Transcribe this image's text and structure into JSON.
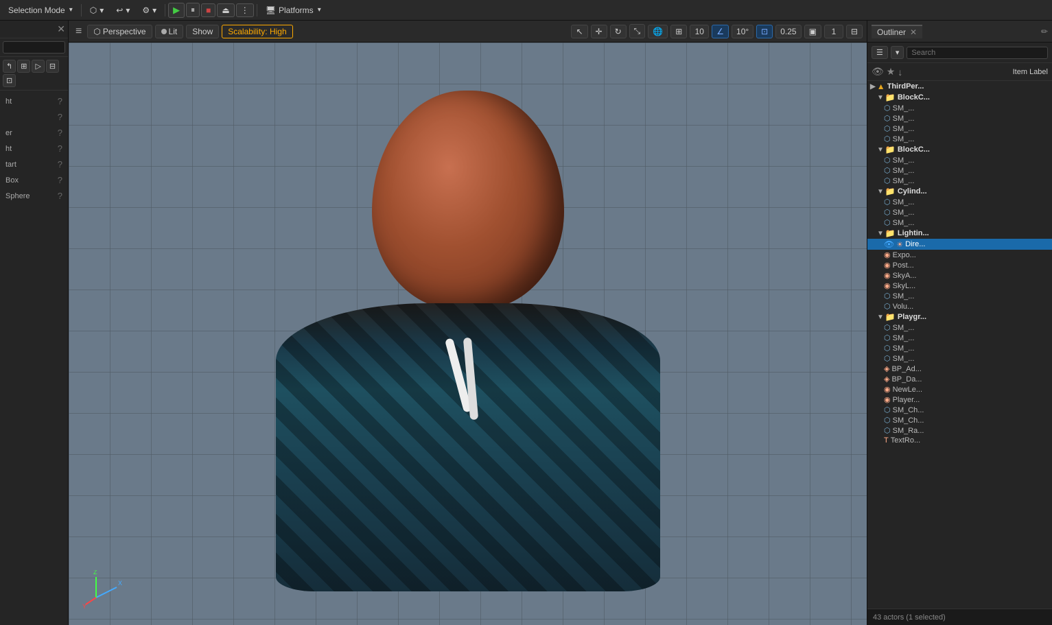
{
  "topbar": {
    "selection_mode_label": "Selection Mode",
    "selection_mode_arrow": "▾",
    "platforms_label": "Platforms",
    "platforms_arrow": "▾",
    "play_btn": "▶",
    "pause_btn": "⏸",
    "stop_btn": "■",
    "eject_btn": "⏏",
    "more_btn": "⋮",
    "blueprint_icon": "⬡",
    "history_icon": "↩",
    "settings_icon": "⚙",
    "cinematics_icon": "🎬"
  },
  "left_panel": {
    "search_placeholder": "",
    "items": [
      {
        "label": "ht",
        "has_help": true
      },
      {
        "label": "",
        "has_help": true
      },
      {
        "label": "er",
        "has_help": true
      },
      {
        "label": "ht",
        "has_help": true
      },
      {
        "label": "tart",
        "has_help": true
      },
      {
        "label": "Box",
        "has_help": true
      },
      {
        "label": "Sphere",
        "has_help": true
      }
    ]
  },
  "viewport": {
    "perspective_label": "Perspective",
    "lit_label": "Lit",
    "show_label": "Show",
    "scalability_label": "Scalability: High",
    "grid_num": "10",
    "angle_num": "10°",
    "scale_num": "0.25",
    "screen_num": "1"
  },
  "outliner": {
    "tab_label": "Outliner",
    "search_placeholder": "Search",
    "col_label": "Item Label",
    "status": "43 actors (1 selected)",
    "items": [
      {
        "label": "ThirdPer...",
        "level": 0,
        "type": "root",
        "visible": true
      },
      {
        "label": "BlockC...",
        "level": 1,
        "type": "folder",
        "visible": true,
        "open": true
      },
      {
        "label": "SM_...",
        "level": 2,
        "type": "mesh",
        "visible": true
      },
      {
        "label": "SM_...",
        "level": 2,
        "type": "mesh",
        "visible": true
      },
      {
        "label": "SM_...",
        "level": 2,
        "type": "mesh",
        "visible": true
      },
      {
        "label": "SM_...",
        "level": 2,
        "type": "mesh",
        "visible": true
      },
      {
        "label": "BlockC...",
        "level": 1,
        "type": "folder",
        "visible": true,
        "open": true
      },
      {
        "label": "SM_...",
        "level": 2,
        "type": "mesh",
        "visible": true
      },
      {
        "label": "SM_...",
        "level": 2,
        "type": "mesh",
        "visible": true
      },
      {
        "label": "SM_...",
        "level": 2,
        "type": "mesh",
        "visible": true
      },
      {
        "label": "Cylind...",
        "level": 1,
        "type": "folder",
        "visible": true,
        "open": true
      },
      {
        "label": "SM_...",
        "level": 2,
        "type": "mesh",
        "visible": true
      },
      {
        "label": "SM_...",
        "level": 2,
        "type": "mesh",
        "visible": true
      },
      {
        "label": "SM_...",
        "level": 2,
        "type": "mesh",
        "visible": true
      },
      {
        "label": "Lightin...",
        "level": 1,
        "type": "folder",
        "visible": true,
        "open": true
      },
      {
        "label": "Dire...",
        "level": 2,
        "type": "light",
        "visible": true,
        "selected": true
      },
      {
        "label": "Expo...",
        "level": 2,
        "type": "light",
        "visible": true
      },
      {
        "label": "Post...",
        "level": 2,
        "type": "light",
        "visible": true
      },
      {
        "label": "SkyA...",
        "level": 2,
        "type": "light",
        "visible": true
      },
      {
        "label": "SkyL...",
        "level": 2,
        "type": "light",
        "visible": true
      },
      {
        "label": "SM_...",
        "level": 2,
        "type": "mesh",
        "visible": true
      },
      {
        "label": "Volu...",
        "level": 2,
        "type": "mesh",
        "visible": true
      },
      {
        "label": "Playgr...",
        "level": 1,
        "type": "folder",
        "visible": true,
        "open": true
      },
      {
        "label": "SM_...",
        "level": 2,
        "type": "mesh",
        "visible": true
      },
      {
        "label": "SM_...",
        "level": 2,
        "type": "mesh",
        "visible": true
      },
      {
        "label": "SM_...",
        "level": 2,
        "type": "mesh",
        "visible": true
      },
      {
        "label": "SM_...",
        "level": 2,
        "type": "mesh",
        "visible": true
      },
      {
        "label": "BP_Ad...",
        "level": 2,
        "type": "blueprint",
        "visible": true
      },
      {
        "label": "BP_Da...",
        "level": 2,
        "type": "blueprint",
        "visible": true
      },
      {
        "label": "NewLe...",
        "level": 2,
        "type": "other",
        "visible": true
      },
      {
        "label": "Player...",
        "level": 2,
        "type": "other",
        "visible": true
      },
      {
        "label": "SM_Ch...",
        "level": 2,
        "type": "mesh",
        "visible": true
      },
      {
        "label": "SM_Ch...",
        "level": 2,
        "type": "mesh",
        "visible": true
      },
      {
        "label": "SM_Ra...",
        "level": 2,
        "type": "mesh",
        "visible": true
      },
      {
        "label": "TextRo...",
        "level": 2,
        "type": "other",
        "visible": true
      }
    ]
  }
}
